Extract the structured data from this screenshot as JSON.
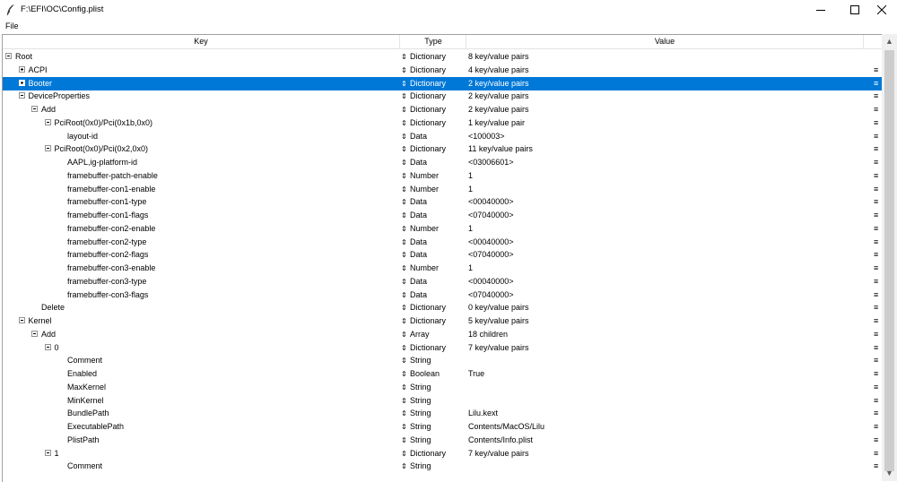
{
  "window": {
    "title": "F:\\EFI\\OC\\Config.plist"
  },
  "menubar": {
    "file": "File"
  },
  "headers": {
    "key": "Key",
    "type": "Type",
    "value": "Value"
  },
  "rows": [
    {
      "key": "Root",
      "type": "Dictionary",
      "value": "8 key/value pairs",
      "level": 0,
      "exp": "minus",
      "menu": false
    },
    {
      "key": "ACPI",
      "type": "Dictionary",
      "value": "4 key/value pairs",
      "level": 1,
      "exp": "plus",
      "menu": true
    },
    {
      "key": "Booter",
      "type": "Dictionary",
      "value": "2 key/value pairs",
      "level": 1,
      "exp": "plus",
      "menu": true,
      "selected": true
    },
    {
      "key": "DeviceProperties",
      "type": "Dictionary",
      "value": "2 key/value pairs",
      "level": 1,
      "exp": "minus",
      "menu": true
    },
    {
      "key": "Add",
      "type": "Dictionary",
      "value": "2 key/value pairs",
      "level": 2,
      "exp": "minus",
      "menu": true
    },
    {
      "key": "PciRoot(0x0)/Pci(0x1b,0x0)",
      "type": "Dictionary",
      "value": "1 key/value pair",
      "level": 3,
      "exp": "minus",
      "menu": true
    },
    {
      "key": "layout-id",
      "type": "Data",
      "value": "<100003>",
      "level": 4,
      "menu": true
    },
    {
      "key": "PciRoot(0x0)/Pci(0x2,0x0)",
      "type": "Dictionary",
      "value": "11 key/value pairs",
      "level": 3,
      "exp": "minus",
      "menu": true
    },
    {
      "key": "AAPL,ig-platform-id",
      "type": "Data",
      "value": "<03006601>",
      "level": 4,
      "menu": true
    },
    {
      "key": "framebuffer-patch-enable",
      "type": "Number",
      "value": "1",
      "level": 4,
      "menu": true
    },
    {
      "key": "framebuffer-con1-enable",
      "type": "Number",
      "value": "1",
      "level": 4,
      "menu": true
    },
    {
      "key": "framebuffer-con1-type",
      "type": "Data",
      "value": "<00040000>",
      "level": 4,
      "menu": true
    },
    {
      "key": "framebuffer-con1-flags",
      "type": "Data",
      "value": "<07040000>",
      "level": 4,
      "menu": true
    },
    {
      "key": "framebuffer-con2-enable",
      "type": "Number",
      "value": "1",
      "level": 4,
      "menu": true
    },
    {
      "key": "framebuffer-con2-type",
      "type": "Data",
      "value": "<00040000>",
      "level": 4,
      "menu": true
    },
    {
      "key": "framebuffer-con2-flags",
      "type": "Data",
      "value": "<07040000>",
      "level": 4,
      "menu": true
    },
    {
      "key": "framebuffer-con3-enable",
      "type": "Number",
      "value": "1",
      "level": 4,
      "menu": true
    },
    {
      "key": "framebuffer-con3-type",
      "type": "Data",
      "value": "<00040000>",
      "level": 4,
      "menu": true
    },
    {
      "key": "framebuffer-con3-flags",
      "type": "Data",
      "value": "<07040000>",
      "level": 4,
      "menu": true
    },
    {
      "key": "Delete",
      "type": "Dictionary",
      "value": "0 key/value pairs",
      "level": 2,
      "menu": true
    },
    {
      "key": "Kernel",
      "type": "Dictionary",
      "value": "5 key/value pairs",
      "level": 1,
      "exp": "minus",
      "menu": true
    },
    {
      "key": "Add",
      "type": "Array",
      "value": "18 children",
      "level": 2,
      "exp": "minus",
      "menu": true
    },
    {
      "key": "0",
      "type": "Dictionary",
      "value": "7 key/value pairs",
      "level": 3,
      "exp": "minus",
      "menu": true
    },
    {
      "key": "Comment",
      "type": "String",
      "value": "",
      "level": 4,
      "menu": true
    },
    {
      "key": "Enabled",
      "type": "Boolean",
      "value": "True",
      "level": 4,
      "menu": true
    },
    {
      "key": "MaxKernel",
      "type": "String",
      "value": "",
      "level": 4,
      "menu": true
    },
    {
      "key": "MinKernel",
      "type": "String",
      "value": "",
      "level": 4,
      "menu": true
    },
    {
      "key": "BundlePath",
      "type": "String",
      "value": "Lilu.kext",
      "level": 4,
      "menu": true
    },
    {
      "key": "ExecutablePath",
      "type": "String",
      "value": "Contents/MacOS/Lilu",
      "level": 4,
      "menu": true
    },
    {
      "key": "PlistPath",
      "type": "String",
      "value": "Contents/Info.plist",
      "level": 4,
      "menu": true
    },
    {
      "key": "1",
      "type": "Dictionary",
      "value": "7 key/value pairs",
      "level": 3,
      "exp": "minus",
      "menu": true
    },
    {
      "key": "Comment",
      "type": "String",
      "value": "",
      "level": 4,
      "menu": true
    }
  ]
}
